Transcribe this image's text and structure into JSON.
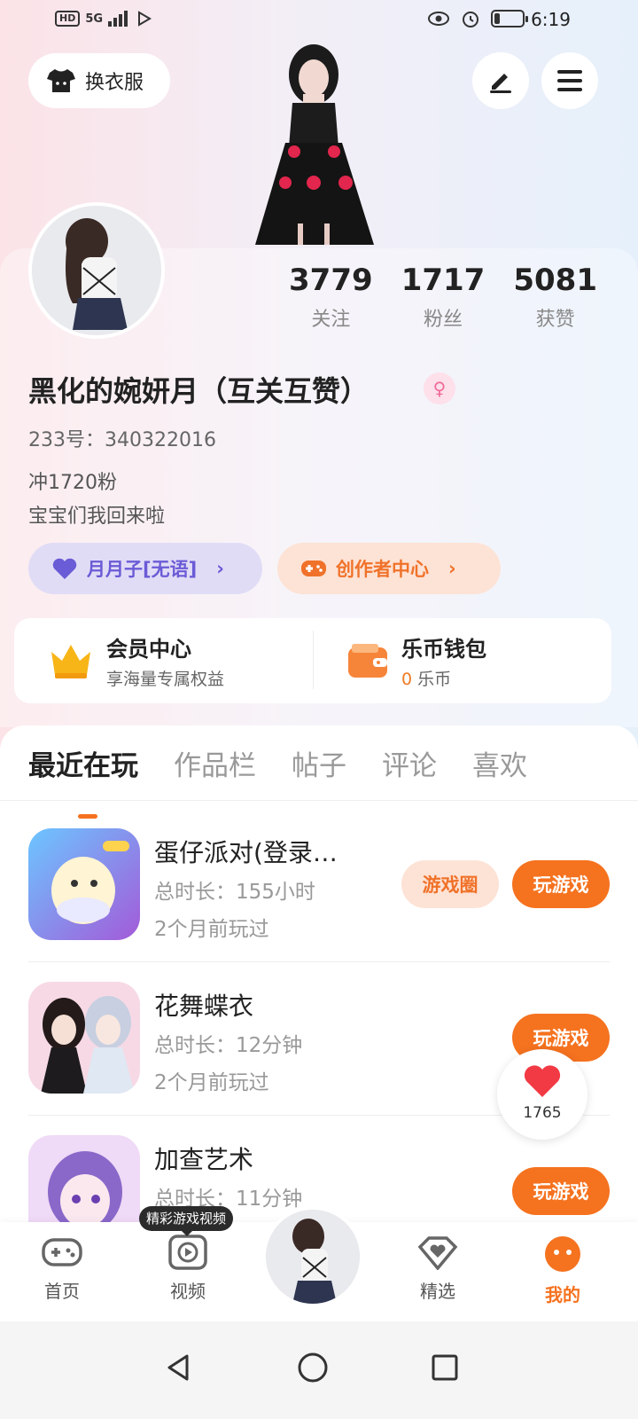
{
  "status_bar": {
    "network_hd": "HD",
    "network_5g": "5G",
    "time": "6:19",
    "icons": [
      "eye-icon",
      "alarm-icon",
      "battery-icon"
    ]
  },
  "top": {
    "outfit_label": "换衣服",
    "edit_icon": "pen-icon",
    "menu_icon": "hamburger-icon"
  },
  "profile": {
    "stats": [
      {
        "num": "3779",
        "label": "关注"
      },
      {
        "num": "1717",
        "label": "粉丝"
      },
      {
        "num": "5081",
        "label": "获赞"
      }
    ],
    "username": "黑化的婉妍月（互关互赞）",
    "gender_icon": "female-icon",
    "uid": "233号：340322016",
    "bio_line1": "冲1720粉",
    "bio_line2": "宝宝们我回来啦",
    "mood_pill": "月月子[无语]",
    "creator_pill": "创作者中心"
  },
  "vip": {
    "member_title": "会员中心",
    "member_sub": "享海量专属权益",
    "wallet_title": "乐币钱包",
    "wallet_amount": "0",
    "wallet_unit": "乐币"
  },
  "tabs": [
    "最近在玩",
    "作品栏",
    "帖子",
    "评论",
    "喜欢"
  ],
  "games": [
    {
      "name": "蛋仔派对(登录…",
      "duration": "总时长：155小时",
      "ago": "2个月前玩过",
      "circle_label": "游戏圈",
      "play_label": "玩游戏"
    },
    {
      "name": "花舞蝶衣",
      "duration": "总时长：12分钟",
      "ago": "2个月前玩过",
      "play_label": "玩游戏"
    },
    {
      "name": "加查艺术",
      "duration": "总时长：11分钟",
      "play_label": "玩游戏"
    }
  ],
  "float_like": {
    "count": "1765"
  },
  "bottom_nav": {
    "tooltip": "精彩游戏视频",
    "items": [
      {
        "label": "首页",
        "icon": "gamepad-icon"
      },
      {
        "label": "视频",
        "icon": "video-play-icon"
      },
      {
        "label": "精选",
        "icon": "heart-box-icon"
      },
      {
        "label": "我的",
        "icon": "smiley-icon"
      }
    ]
  },
  "colors": {
    "accent": "#f5721f",
    "purple": "#6a5bd6"
  }
}
